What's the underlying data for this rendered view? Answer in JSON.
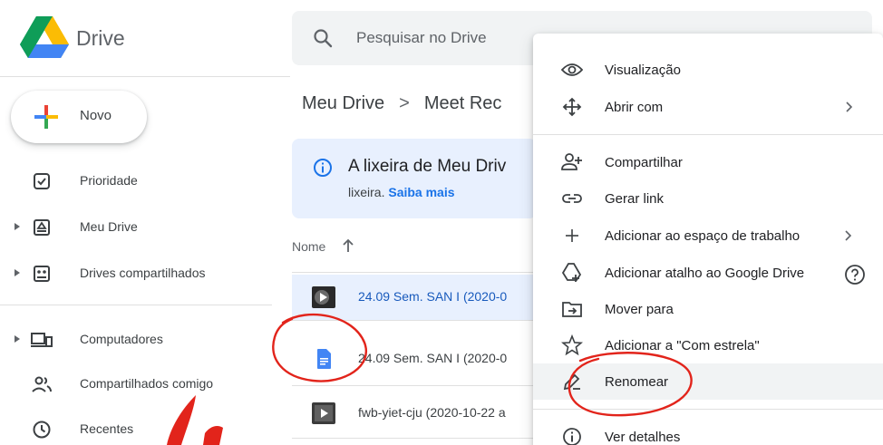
{
  "app": {
    "name": "Drive"
  },
  "search": {
    "placeholder": "Pesquisar no Drive"
  },
  "sidebar": {
    "new_label": "Novo",
    "items": [
      {
        "label": "Prioridade",
        "icon": "checkbox-icon",
        "expandable": false
      },
      {
        "label": "Meu Drive",
        "icon": "my-drive-icon",
        "expandable": true
      },
      {
        "label": "Drives compartilhados",
        "icon": "shared-drives-icon",
        "expandable": true
      },
      {
        "label": "Computadores",
        "icon": "computers-icon",
        "expandable": true
      },
      {
        "label": "Compartilhados comigo",
        "icon": "shared-with-me-icon",
        "expandable": false
      },
      {
        "label": "Recentes",
        "icon": "clock-icon",
        "expandable": false
      }
    ]
  },
  "breadcrumb": {
    "root": "Meu Drive",
    "current": "Meet Rec"
  },
  "banner": {
    "title": "A lixeira de Meu Driv",
    "text": "lixeira.",
    "link": "Saiba mais"
  },
  "file_list": {
    "column_name": "Nome",
    "files": [
      {
        "name": "24.09 Sem. SAN I (2020-0",
        "type": "video",
        "selected": true
      },
      {
        "name": "24.09 Sem. SAN I (2020-0",
        "type": "document",
        "selected": false
      },
      {
        "name": "fwb-yiet-cju (2020-10-22 a",
        "type": "video",
        "selected": false
      }
    ]
  },
  "context_menu": {
    "items": [
      {
        "label": "Visualização",
        "icon": "eye-icon"
      },
      {
        "label": "Abrir com",
        "icon": "open-with-icon",
        "submenu": true
      },
      {
        "label": "Compartilhar",
        "icon": "person-add-icon"
      },
      {
        "label": "Gerar link",
        "icon": "link-icon"
      },
      {
        "label": "Adicionar ao espaço de trabalho",
        "icon": "plus-icon",
        "submenu": true
      },
      {
        "label": "Adicionar atalho ao Google Drive",
        "icon": "add-shortcut-icon",
        "help": true
      },
      {
        "label": "Mover para",
        "icon": "move-to-folder-icon"
      },
      {
        "label": "Adicionar a \"Com estrela\"",
        "icon": "star-icon"
      },
      {
        "label": "Renomear",
        "icon": "pencil-icon",
        "hovered": true
      },
      {
        "label": "Ver detalhes",
        "icon": "info-icon"
      }
    ]
  },
  "colors": {
    "accent_blue": "#1a73e8",
    "selected_row": "#e8f0fe",
    "annotation_red": "#e2241b"
  }
}
